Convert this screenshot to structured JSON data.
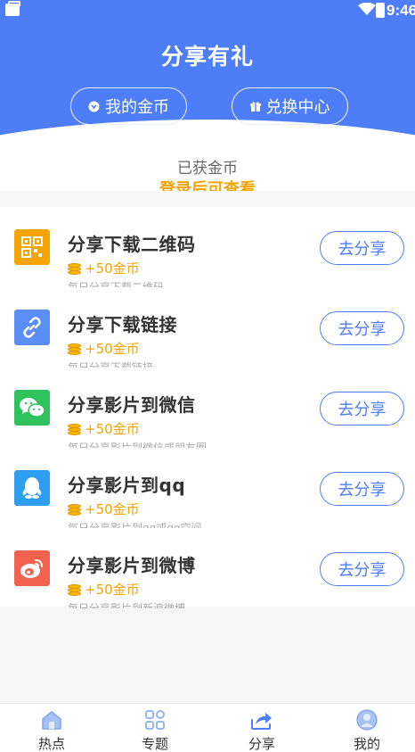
{
  "status_bar": {
    "time": "9:46"
  },
  "header": {
    "title": "分享有礼",
    "my_coins_label": "我的金币",
    "exchange_label": "兑换中心"
  },
  "coins": {
    "label": "已获金币",
    "value": "登录后可查看"
  },
  "tasks": [
    {
      "title": "分享下载二维码",
      "reward": "+50金币",
      "desc": "每日分享下载二维码",
      "button": "去分享",
      "icon": "qrcode-icon",
      "color": "#f5a400"
    },
    {
      "title": "分享下载链接",
      "reward": "+50金币",
      "desc": "每日分享下载链接",
      "button": "去分享",
      "icon": "link-icon",
      "color": "#5b8ef4"
    },
    {
      "title": "分享影片到微信",
      "reward": "+50金币",
      "desc": "每日分享影片到微信或朋友圈",
      "button": "去分享",
      "icon": "wechat-icon",
      "color": "#2fc15b"
    },
    {
      "title": "分享影片到qq",
      "reward": "+50金币",
      "desc": "每日分享影片到qq或qq空间",
      "button": "去分享",
      "icon": "qq-icon",
      "color": "#2e9ef0"
    },
    {
      "title": "分享影片到微博",
      "reward": "+50金币",
      "desc": "每日分享影片到新浪微博",
      "button": "去分享",
      "icon": "weibo-icon",
      "color": "#f0614e"
    }
  ],
  "tabs": [
    {
      "label": "热点",
      "icon": "home-icon"
    },
    {
      "label": "专题",
      "icon": "topics-icon"
    },
    {
      "label": "分享",
      "icon": "share-icon"
    },
    {
      "label": "我的",
      "icon": "profile-icon"
    }
  ]
}
